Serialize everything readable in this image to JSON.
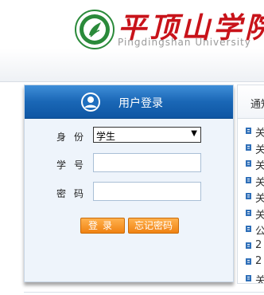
{
  "header": {
    "cn_name": "平顶山学院",
    "en_name": "Pingdingshan University"
  },
  "login": {
    "title": "用户登录",
    "identity_label": "身份",
    "identity_value": "学生",
    "username_label": "学号",
    "password_label": "密码",
    "login_button": "登录",
    "forgot_button": "忘记密码"
  },
  "notice": {
    "tab_label": "通知",
    "items": [
      "关",
      "关",
      "关",
      "关",
      "关",
      "关",
      "公",
      "2",
      "2",
      "关"
    ]
  },
  "colors": {
    "title_bar": "#1a67b6",
    "button": "#f08212",
    "brand_red": "#c8131a",
    "brand_green": "#2a8a3a"
  },
  "icons": {
    "logo": "university-seal-icon",
    "user": "user-avatar-icon",
    "bullet": "document-bullet-icon"
  }
}
